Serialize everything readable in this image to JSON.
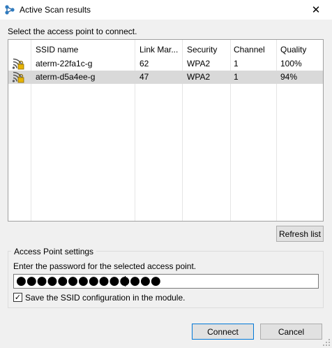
{
  "window": {
    "title": "Active Scan results",
    "close_glyph": "✕"
  },
  "prompt": "Select the access point to connect.",
  "table": {
    "columns": [
      "SSID name",
      "Link Mar...",
      "Security",
      "Channel",
      "Quality"
    ],
    "rows": [
      {
        "ssid": "aterm-22fa1c-g",
        "link_margin": "62",
        "security": "WPA2",
        "channel": "1",
        "quality": "100%",
        "selected": false,
        "icon": "wifi-lock-icon"
      },
      {
        "ssid": "aterm-d5a4ee-g",
        "link_margin": "47",
        "security": "WPA2",
        "channel": "1",
        "quality": "94%",
        "selected": true,
        "icon": "wifi-lock-icon"
      }
    ]
  },
  "refresh_label": "Refresh list",
  "ap_settings": {
    "legend": "Access Point settings",
    "instruction": "Enter the password for the selected access point.",
    "password_mask": "●●●●●●●●●●●●●●",
    "save_ssid_label": "Save the SSID configuration in the module.",
    "save_ssid_checked": true,
    "check_glyph": "✓"
  },
  "buttons": {
    "connect": "Connect",
    "cancel": "Cancel"
  },
  "colors": {
    "selection": "#d9d9d9",
    "default_button_border": "#0078d7",
    "icon_lock": "#e8b400"
  }
}
